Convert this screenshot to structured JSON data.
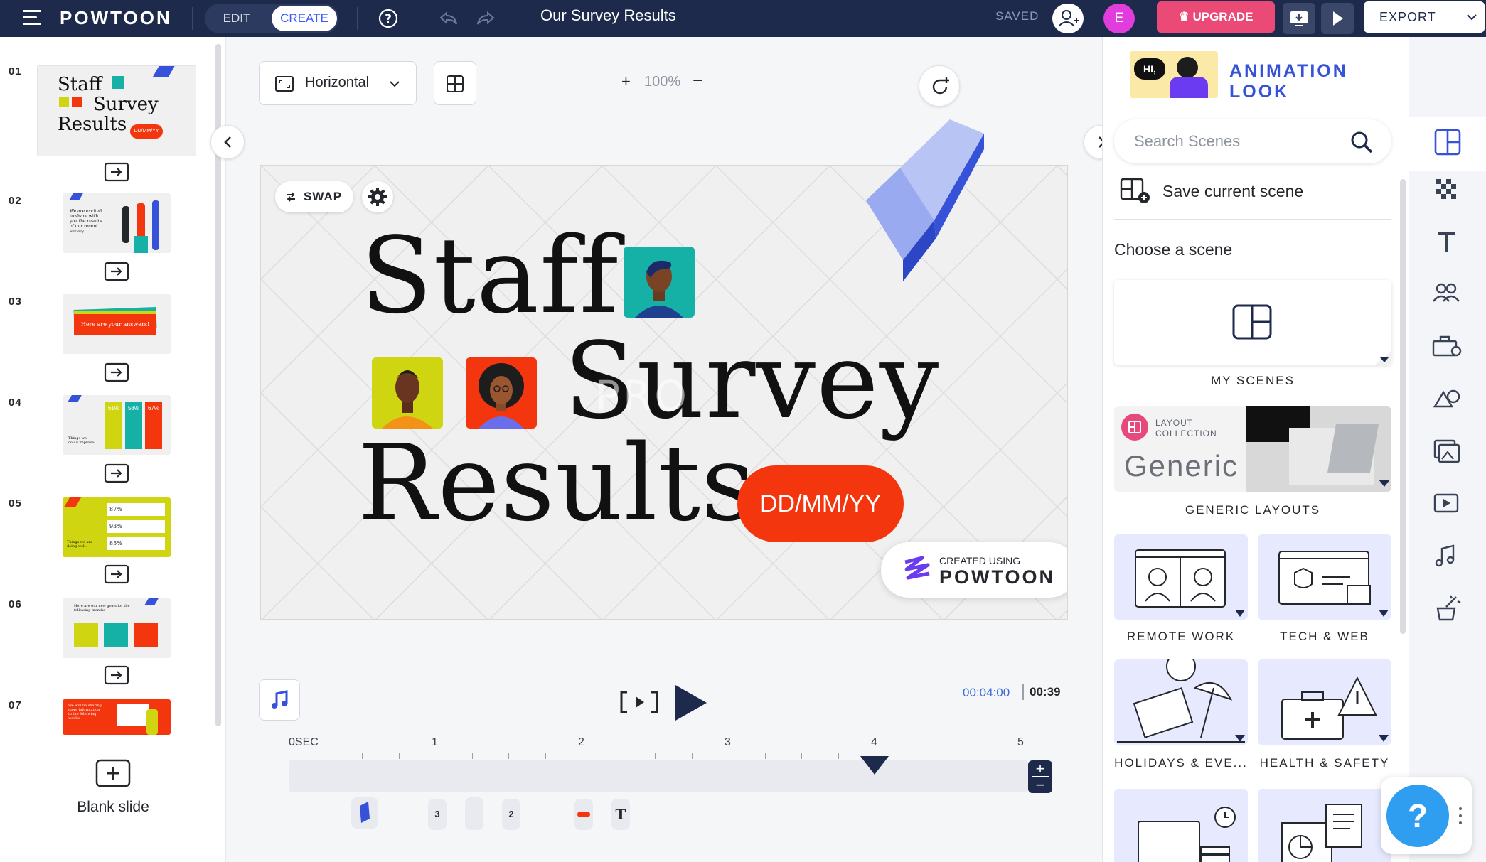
{
  "topbar": {
    "logo": "POWTOON",
    "mode_edit": "EDIT",
    "mode_create": "CREATE",
    "doc_title": "Our Survey Results",
    "saved": "SAVED",
    "user_initial": "E",
    "upgrade": "UPGRADE",
    "export": "EXPORT",
    "colors": {
      "bar": "#1e2a4b",
      "upgrade": "#ec4a76",
      "avatar": "#e03ddc",
      "accent": "#3b5bfd"
    }
  },
  "slides": {
    "items": [
      {
        "num": "01",
        "title_lines": [
          "Staff",
          "Survey",
          "Results"
        ],
        "pill": "DD/MM/YY"
      },
      {
        "num": "02",
        "text": "We are excited to share with you the results of our recent survey"
      },
      {
        "num": "03",
        "text": "Here are your answers!"
      },
      {
        "num": "04",
        "values": [
          "61%",
          "58%",
          "67%"
        ],
        "text": "Things we could improve:"
      },
      {
        "num": "05",
        "values": [
          "87%",
          "93%",
          "85%"
        ],
        "text": "Things we are doing well:"
      },
      {
        "num": "06",
        "text": "Here are our new goals for the following months"
      },
      {
        "num": "07",
        "text": "We will be sharing more information in the following weeks"
      }
    ],
    "blank_label": "Blank slide"
  },
  "editor": {
    "orientation": "Horizontal",
    "zoom": "100%",
    "swap": "SWAP",
    "canvas": {
      "line1": "Staff",
      "line2": "Survey",
      "line3": "Results",
      "date": "DD/MM/YY",
      "watermark": "PRO",
      "badge_small": "CREATED USING",
      "badge_logo": "POWTOON"
    },
    "timeline": {
      "current_time": "00:04:00",
      "total_time": "00:39",
      "ruler": [
        "0SEC",
        "1",
        "2",
        "3",
        "4",
        "5"
      ],
      "playhead_sec": 4,
      "layer_badges": [
        "3",
        "2",
        "T"
      ]
    }
  },
  "right_panel": {
    "header": "ANIMATION LOOK",
    "header_bubble": "HI,",
    "search_placeholder": "Search Scenes",
    "save_scene": "Save current scene",
    "choose_scene": "Choose a scene",
    "my_scenes": "MY SCENES",
    "layout_collection_label": "LAYOUT COLLECTION",
    "generic_title": "Generic",
    "generic_layouts": "GENERIC LAYOUTS",
    "categories": [
      "REMOTE WORK",
      "TECH & WEB",
      "HOLIDAYS & EVE...",
      "HEALTH & SAFETY"
    ],
    "help": "?"
  }
}
